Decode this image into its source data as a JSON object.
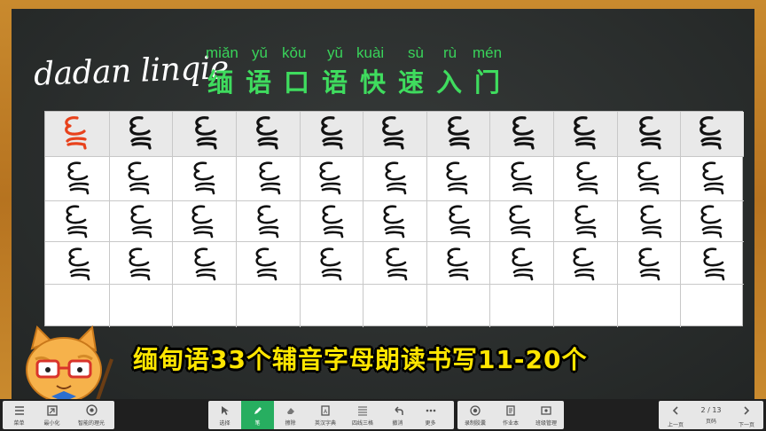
{
  "title": {
    "brand": "dadan linqie",
    "pinyin": [
      "miǎn",
      "yǔ",
      "kǒu",
      "yǔ",
      "kuài",
      "sù",
      "rù",
      "mén"
    ],
    "hanzi": [
      "缅",
      "语",
      "口",
      "语",
      "快",
      "速",
      "入",
      "门"
    ]
  },
  "banner": "缅甸语33个辅音字母朗读书写11-20个",
  "toolbar": {
    "left": [
      {
        "icon": "menu-icon",
        "label": "菜单"
      },
      {
        "icon": "minimize-icon",
        "label": "最小化"
      },
      {
        "icon": "smart-wallpaper-icon",
        "label": "智能的理光"
      }
    ],
    "center": [
      {
        "icon": "cursor-icon",
        "label": "选择"
      },
      {
        "icon": "pen-icon",
        "label": "笔"
      },
      {
        "icon": "eraser-icon",
        "label": "擦除"
      },
      {
        "icon": "dictionary-icon",
        "label": "英汉字典"
      },
      {
        "icon": "four-line-grid-icon",
        "label": "四线三格"
      },
      {
        "icon": "undo-icon",
        "label": "撤消"
      },
      {
        "icon": "more-icon",
        "label": "更多"
      }
    ],
    "right": [
      {
        "icon": "record-icon",
        "label": "录制胶囊"
      },
      {
        "icon": "homework-icon",
        "label": "作业本"
      },
      {
        "icon": "class-manage-icon",
        "label": "班级管理"
      }
    ],
    "pager": {
      "prev_label": "上一页",
      "page_text": "2 / 13",
      "page_label": "页码",
      "next_label": "下一页"
    }
  },
  "colors": {
    "board": "#2b2f2e",
    "pinyin": "#39d35a",
    "hanzi": "#3fdc5e",
    "banner": "#ffe600",
    "active_tool": "#27ae60",
    "reference_glyph": "#e8421c"
  }
}
